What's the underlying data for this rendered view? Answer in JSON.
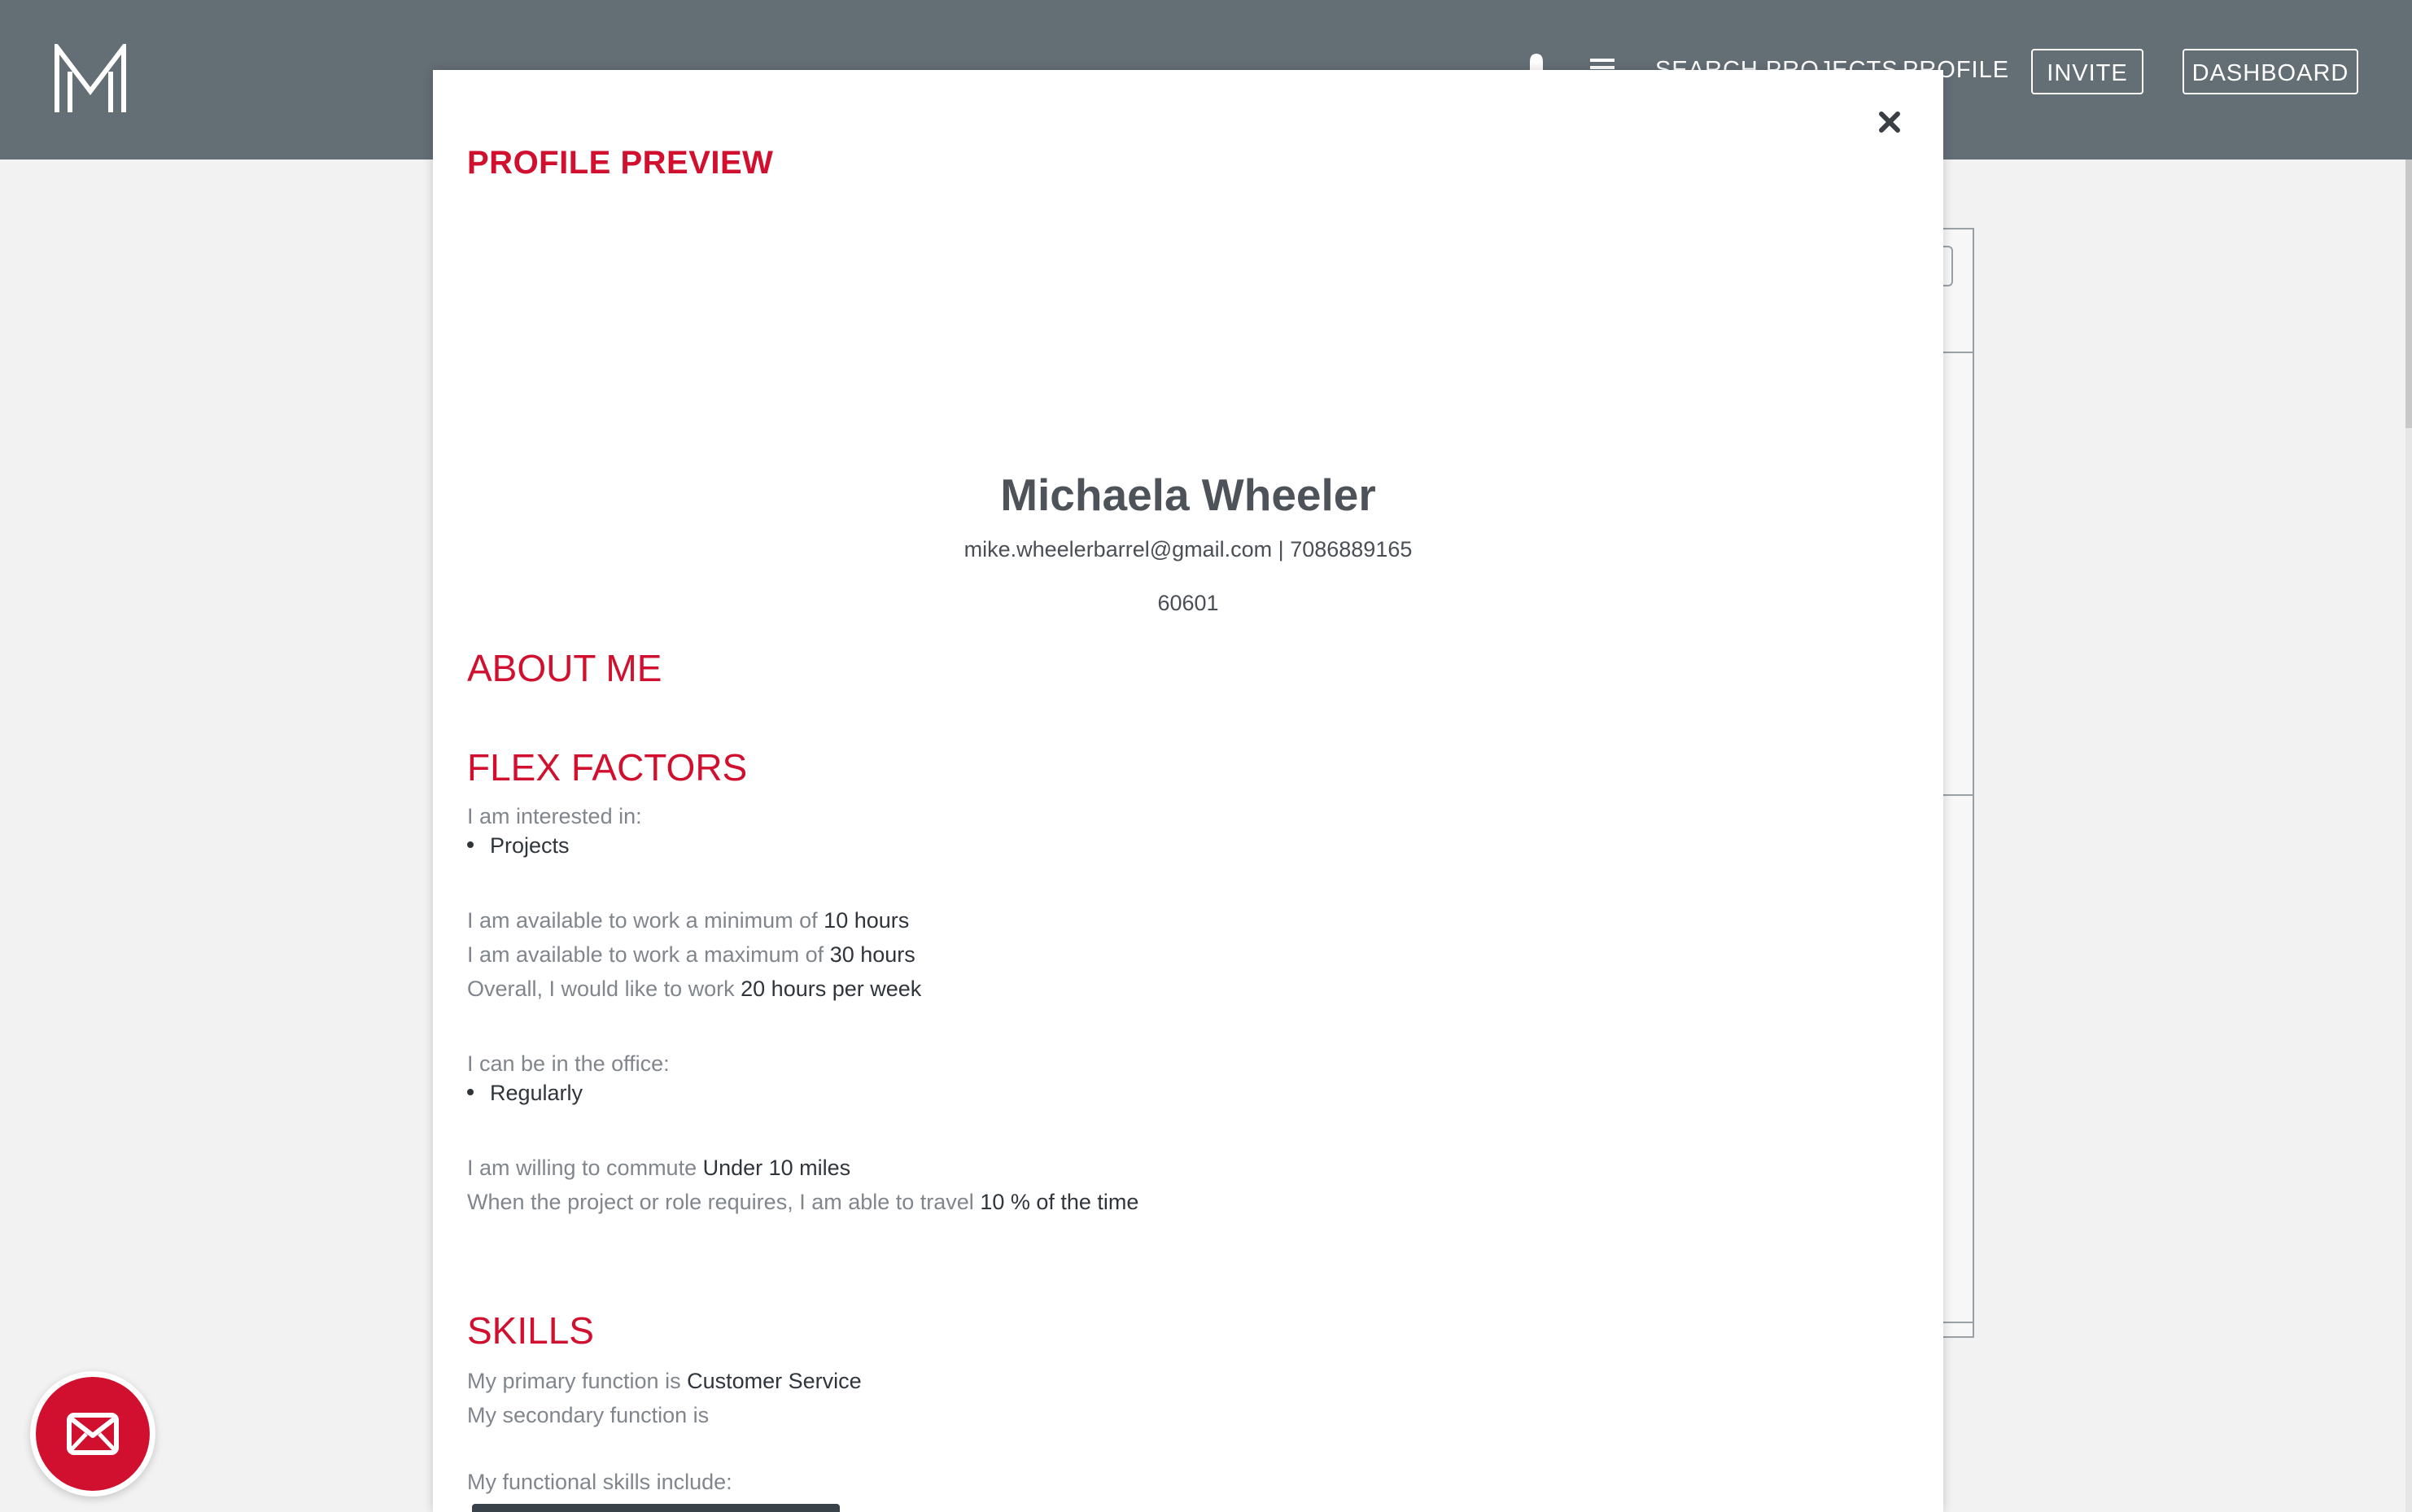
{
  "topbar": {
    "logo_letter": "M",
    "search_projects": "SEARCH PROJECTS",
    "profile": "PROFILE",
    "invite": "INVITE",
    "dashboard": "DASHBOARD",
    "background_color": "#646e75"
  },
  "modal": {
    "title": "PROFILE PREVIEW",
    "close_icon": "close-icon",
    "name": "Michaela Wheeler",
    "email": "mike.wheelerbarrel@gmail.com",
    "separator": "|",
    "phone": "7086889165",
    "zip": "60601",
    "about_heading": "ABOUT ME",
    "flex": {
      "heading": "FLEX FACTORS",
      "interested_label": "I am interested in:",
      "interested_items": [
        "Projects"
      ],
      "min_prefix": "I am available to work a minimum of",
      "min_value": "10 hours",
      "max_prefix": "I am available to work a maximum of",
      "max_value": "30 hours",
      "overall_prefix": "Overall, I would like to work",
      "overall_value": "20 hours per week",
      "office_label": "I can be in the office:",
      "office_items": [
        "Regularly"
      ],
      "commute_prefix": "I am willing to commute",
      "commute_value": "Under 10 miles",
      "travel_prefix": "When the project or role requires, I am able to travel",
      "travel_value": "10 % of the time"
    },
    "skills": {
      "heading": "SKILLS",
      "primary_prefix": "My primary function is",
      "primary_value": "Customer Service",
      "secondary_prefix": "My secondary function is",
      "functional_label": "My functional skills include:"
    }
  },
  "colors": {
    "accent": "#d0102e",
    "heading_text": "#4e5359",
    "label_text": "#80868c",
    "value_text": "#2f353b"
  },
  "fab": {
    "icon": "mail-icon"
  }
}
